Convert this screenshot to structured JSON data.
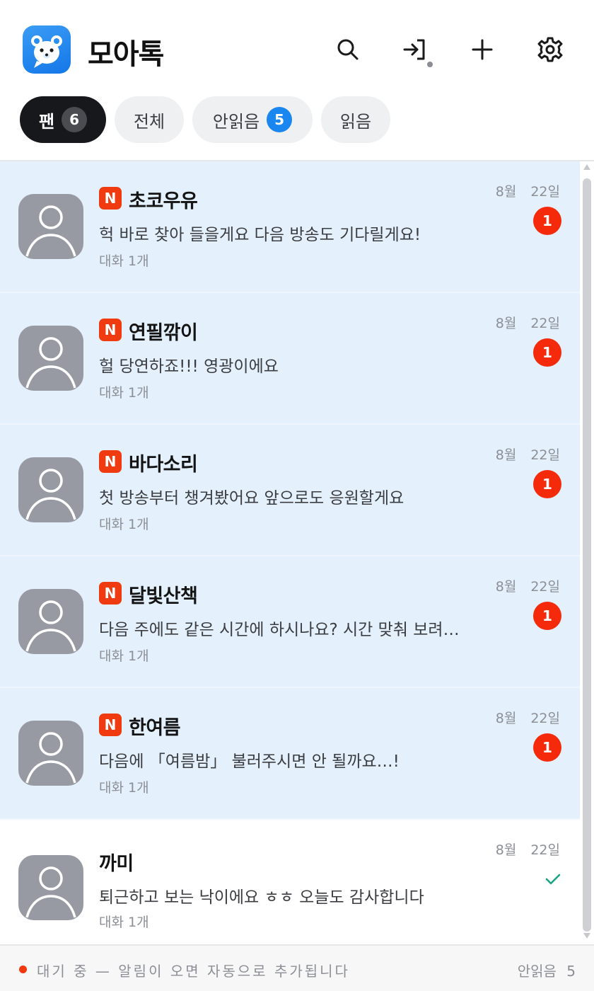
{
  "header": {
    "app_title": "모아톡",
    "icons": [
      "search-icon",
      "login-icon",
      "plus-icon",
      "gear-icon"
    ],
    "brand_color": "#1a86ef"
  },
  "tabs": [
    {
      "label": "팬",
      "count": "6",
      "active": true
    },
    {
      "label": "전체"
    },
    {
      "label": "안읽음",
      "count": "5"
    },
    {
      "label": "읽음"
    }
  ],
  "conversations": [
    {
      "badge": "N",
      "name": "초코우유",
      "message": "헉 바로 찾아 들을게요 다음 방송도 기다릴게요!",
      "sub": "대화 1개",
      "date": "8월 22일",
      "unread": "1"
    },
    {
      "badge": "N",
      "name": "연필깎이",
      "message": "헐 당연하죠!!! 영광이에요",
      "sub": "대화 1개",
      "date": "8월 22일",
      "unread": "1"
    },
    {
      "badge": "N",
      "name": "바다소리",
      "message": "첫 방송부터 챙겨봤어요 앞으로도 응원할게요",
      "sub": "대화 1개",
      "date": "8월 22일",
      "unread": "1"
    },
    {
      "badge": "N",
      "name": "달빛산책",
      "message": "다음 주에도 같은 시간에 하시나요? 시간 맞춰 보려…",
      "sub": "대화 1개",
      "date": "8월 22일",
      "unread": "1"
    },
    {
      "badge": "N",
      "name": "한여름",
      "message": "다음에 「여름밤」 불러주시면 안 될까요…!",
      "sub": "대화 1개",
      "date": "8월 22일",
      "unread": "1"
    },
    {
      "name": "까미",
      "message": "퇴근하고 보는 낙이에요 ㅎㅎ 오늘도 감사합니다",
      "sub": "대화 1개",
      "date": "8월 22일",
      "status": "read-check-icon"
    }
  ],
  "footer": {
    "status_text": "대기 중 — 알림이 오면 자동으로 추가됩니다",
    "unread_summary": "안읽음 5",
    "status_color": "#f2380c"
  }
}
